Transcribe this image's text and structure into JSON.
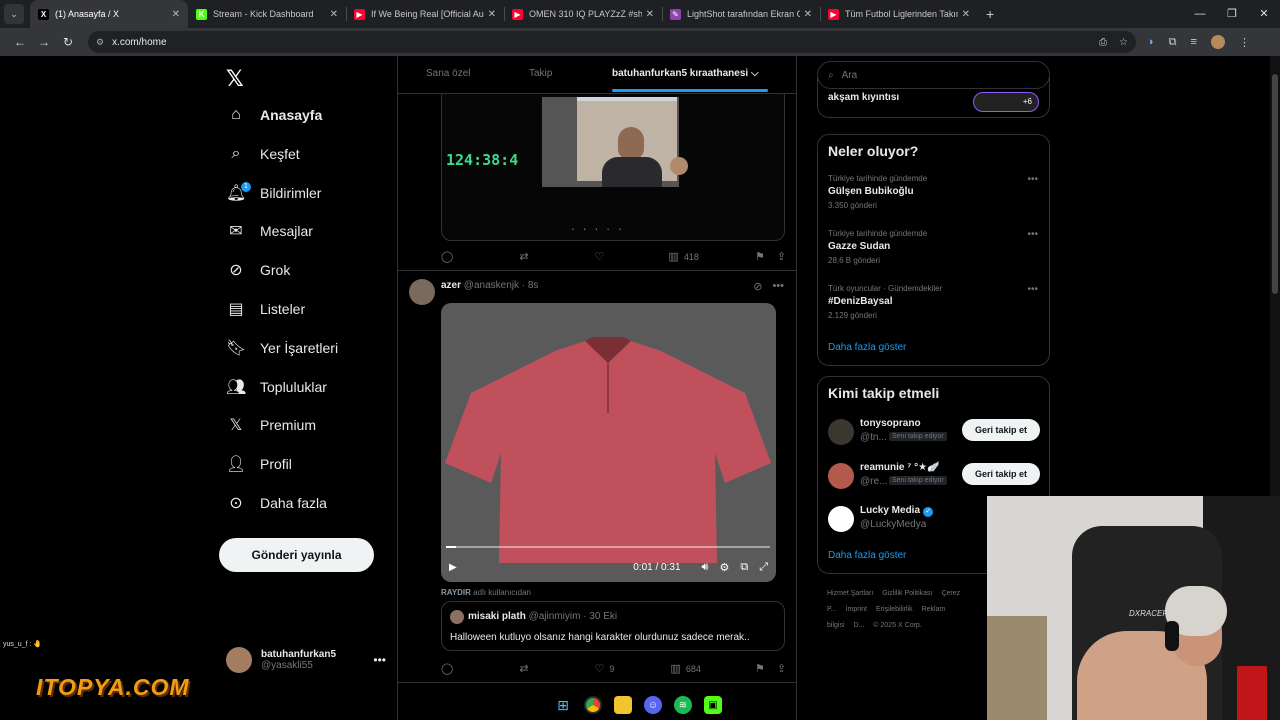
{
  "browser": {
    "tabs": [
      {
        "title": "(1) Anasayfa / X",
        "active": true,
        "fav": "X",
        "fav_color": "#000000"
      },
      {
        "title": "Stream - Kick Dashboard",
        "active": false,
        "fav": "K",
        "fav_color": "#53fc18"
      },
      {
        "title": "If We Being Real [Official Au",
        "active": false,
        "fav": "▶",
        "fav_color": "#ff0033"
      },
      {
        "title": "OMEN 310 IQ PLAYZzZ #sh",
        "active": false,
        "fav": "▶",
        "fav_color": "#ff0033"
      },
      {
        "title": "LightShot tarafından Ekran Gör",
        "active": false,
        "fav": "✎",
        "fav_color": "#8e44ad"
      },
      {
        "title": "Tüm Futbol Liglerinden Takım",
        "active": false,
        "fav": "▶",
        "fav_color": "#ff0033"
      }
    ],
    "url": "x.com/home"
  },
  "nav": {
    "logo": "𝕏",
    "items": [
      {
        "label": "Anasayfa",
        "icon": "⌂",
        "active": true
      },
      {
        "label": "Keşfet",
        "icon": "⌕"
      },
      {
        "label": "Bildirimler",
        "icon": "🔔︎",
        "badge": "1"
      },
      {
        "label": "Mesajlar",
        "icon": "✉"
      },
      {
        "label": "Grok",
        "icon": "⊘"
      },
      {
        "label": "Listeler",
        "icon": "▤"
      },
      {
        "label": "Yer İşaretleri",
        "icon": "🔖︎"
      },
      {
        "label": "Topluluklar",
        "icon": "👥︎"
      },
      {
        "label": "Premium",
        "icon": "𝕏"
      },
      {
        "label": "Profil",
        "icon": "👤︎"
      },
      {
        "label": "Daha fazla",
        "icon": "⊙"
      }
    ],
    "post_button": "Gönderi yayınla",
    "account": {
      "name": "batuhanfurkan5",
      "handle": "@yasakli55",
      "more": "•••"
    }
  },
  "feed": {
    "tabs": [
      "Sana özel",
      "Takip",
      "batuhanfurkan5 kıraathanesi"
    ],
    "post1": {
      "timer": "124:38:4",
      "views": "418"
    },
    "post2": {
      "author": "azer",
      "handle": "@anaskenjk",
      "time": "· 8s",
      "video_time": "0:01 / 0:31",
      "progress": 0.03,
      "shirt_color": "#c0515c",
      "raydir_label": "RAYDIR",
      "raydir_text": "adlı kullanıcıdan",
      "quote_author": "misaki plath",
      "quote_handle": "@ajinmiyim",
      "quote_time": "· 30 Eki",
      "quote_text": "Halloween kutluyo olsanız hangi karakter olurdunuz sadece merak..",
      "likes": "9",
      "views": "684"
    }
  },
  "sidebar": {
    "search_placeholder": "Ara",
    "space_title": "akşam kıyıntısı",
    "space_count": "+6",
    "trends_title": "Neler oluyor?",
    "trends": [
      {
        "context": "Türkiye tarihinde gündemde",
        "title": "Gülşen Bubikoğlu",
        "count": "3.350 gönderi"
      },
      {
        "context": "Türkiye tarihinde gündemde",
        "title": "Gazze Sudan",
        "count": "28,6 B gönderi"
      },
      {
        "context": "Türk oyuncular · Gündemdekiler",
        "title": "#DenizBaysal",
        "count": "2.129 gönderi"
      }
    ],
    "show_more": "Daha fazla göster",
    "who_title": "Kimi takip etmeli",
    "who": [
      {
        "name": "tonysoprano",
        "handle": "@tn...",
        "tag": "Seni takip ediyor",
        "button": "Geri takip et",
        "color": "#3a3630"
      },
      {
        "name": "reamunie ⁷ °★🪽",
        "handle": "@re...",
        "tag": "Seni takip ediyor",
        "button": "Geri takip et",
        "color": "#b45a4c"
      },
      {
        "name": "Lucky Media",
        "handle": "@LuckyMedya",
        "verified": true,
        "color": "#ffffff"
      }
    ],
    "show_more2": "Daha fazla göster",
    "footer": [
      "Hizmet Şartları",
      "Gizlilik Politikası",
      "Çerez P...",
      "İmprint",
      "Erişilebilirlik",
      "Reklam bilgisi",
      "D...",
      "© 2025 X Corp."
    ]
  },
  "overlay": {
    "brand": "ITOPYA.COM",
    "chat": "yus_u_f : 🤚",
    "chair_brand": "DXRACER"
  }
}
